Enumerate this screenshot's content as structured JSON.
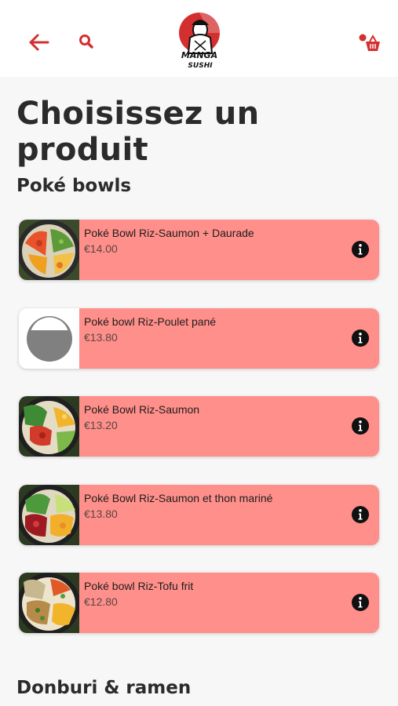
{
  "logo": {
    "text_top": "MANGA",
    "text_bottom": "SUSHI"
  },
  "page_title": "Choisissez un produit",
  "sections": [
    {
      "title": "Poké bowls"
    },
    {
      "title": "Donburi & ramen"
    }
  ],
  "products": [
    {
      "name": "Poké Bowl Riz-Saumon + Daurade",
      "price": "€14.00",
      "image": "salmon-bream-bowl"
    },
    {
      "name": "Poké bowl Riz-Poulet pané",
      "price": "€13.80",
      "image": "placeholder"
    },
    {
      "name": "Poké Bowl Riz-Saumon",
      "price": "€13.20",
      "image": "salmon-bowl"
    },
    {
      "name": "Poké Bowl Riz-Saumon et thon mariné",
      "price": "€13.80",
      "image": "salmon-tuna-bowl"
    },
    {
      "name": "Poké bowl Riz-Tofu frit",
      "price": "€12.80",
      "image": "tofu-bowl"
    }
  ],
  "colors": {
    "accent": "#d32f2f",
    "card_bg": "#ff8f8a",
    "page_bg": "#f7f7f7"
  },
  "icons": [
    "arrow-left-icon",
    "search-icon",
    "cart-icon",
    "info-icon"
  ]
}
